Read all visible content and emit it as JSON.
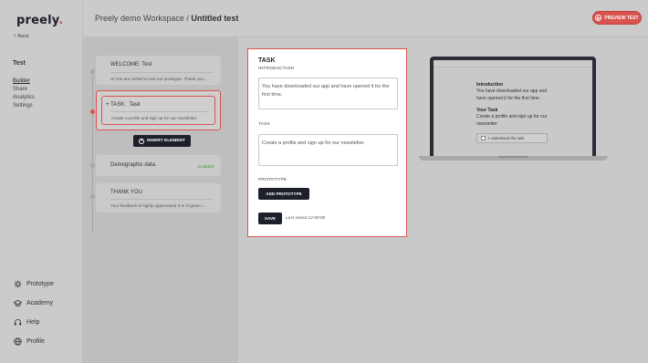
{
  "nav": {
    "logo": "preely",
    "back": "Back",
    "section_title": "Test",
    "items": [
      "Builder",
      "Share",
      "Analytics",
      "Settings"
    ],
    "bottom": [
      {
        "label": "Prototype",
        "icon": "prototype-icon"
      },
      {
        "label": "Academy",
        "icon": "academy-icon"
      },
      {
        "label": "Help",
        "icon": "headset-icon"
      },
      {
        "label": "Profile",
        "icon": "globe-icon"
      }
    ]
  },
  "header": {
    "workspace": "Preely demo Workspace /",
    "test_name": "Untitled test",
    "preview_label": "PREVIEW TEST"
  },
  "builder": {
    "welcome": {
      "title": "WELCOME:  Test",
      "subtitle": "Hi,You are invited to test our prototype. Thank you..."
    },
    "task": {
      "prefix": "TASK:",
      "title": "Task",
      "subtitle": "Create a profile and sign up for our newsletter."
    },
    "insert_label": "INSERT ELEMENT",
    "demographic": {
      "title": "Demographic data",
      "status": "Enabled"
    },
    "thankyou": {
      "title": "THANK YOU",
      "subtitle": "Your feedback is highly appreciated It is of great i..."
    }
  },
  "editor": {
    "title": "TASK",
    "intro_label": "INTRODUCTION",
    "intro_value": "You have downloaded our app and have opened it for the first time.",
    "task_label": "TASK",
    "task_value": "Create a profile and sign up for our newsletter.",
    "prototype_label": "PROTOTYPE",
    "add_prototype": "ADD PROTOTYPE",
    "save": "SAVE",
    "last_saved": "Last saved 12:59:00"
  },
  "preview": {
    "intro_heading": "Introduction",
    "intro_text": "You have downloaded our app and have opened it for the first time.",
    "task_heading": "Your Task",
    "task_text": "Create a profile and sign up for our newsletter.",
    "checkbox_label": "I understand the task"
  },
  "colors": {
    "accent": "#d9534f",
    "dark": "#1d1f2b",
    "enabled": "#3a9a3a"
  }
}
